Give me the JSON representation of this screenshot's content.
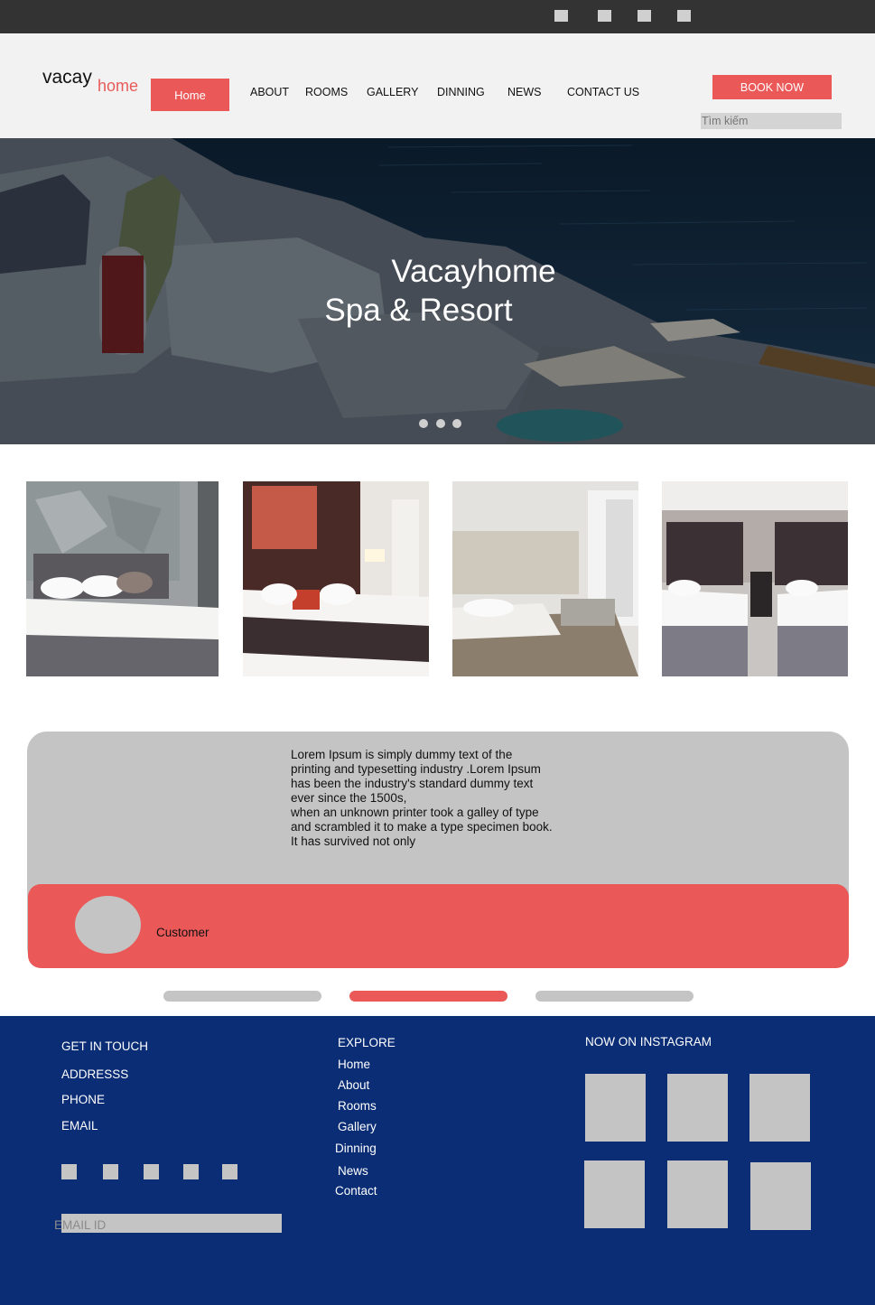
{
  "logo": {
    "part1": "vacay",
    "part2": "home"
  },
  "nav": {
    "home": "Home",
    "about": "ABOUT",
    "rooms": "ROOMS",
    "gallery": "GALLERY",
    "dinning": "DINNING",
    "news": "NEWS",
    "contact": "CONTACT US"
  },
  "book_now": "BOOK NOW",
  "search": {
    "placeholder": "Tìm kiếm"
  },
  "hero": {
    "line1": "Vacayhome",
    "line2": "Spa & Resort",
    "slides": 3,
    "active_slide": 1
  },
  "rooms": [
    {
      "alt": "bedroom-1"
    },
    {
      "alt": "bedroom-2"
    },
    {
      "alt": "bedroom-3"
    },
    {
      "alt": "bedroom-4"
    }
  ],
  "testimonial": {
    "text_lines": [
      "Lorem Ipsum is simply dummy text of the",
      "printing and typesetting industry .Lorem Ipsum",
      "has been the industry's standard dummy text",
      "ever since the 1500s,",
      "when an unknown printer took a galley of type",
      "and scrambled it to make a type specimen book.",
      "It has survived not only"
    ],
    "customer": "Customer",
    "pages": 3,
    "active_page": 2
  },
  "footer": {
    "get_in_touch": {
      "heading": "GET IN TOUCH",
      "address": "ADDRESSS",
      "phone": "PHONE",
      "email": "EMAIL"
    },
    "email_placeholder": "EMAIL ID",
    "explore": {
      "heading": "EXPLORE",
      "links": [
        "Home",
        "About",
        "Rooms",
        "Gallery",
        "Dinning",
        "News",
        "Contact"
      ]
    },
    "instagram": {
      "heading": "NOW ON INSTAGRAM"
    }
  },
  "colors": {
    "accent": "#ea5858",
    "topbar": "#333333",
    "header_bg": "#f2f2f2",
    "footer_bg": "#0a2d75",
    "placeholder_gray": "#c4c4c4"
  }
}
